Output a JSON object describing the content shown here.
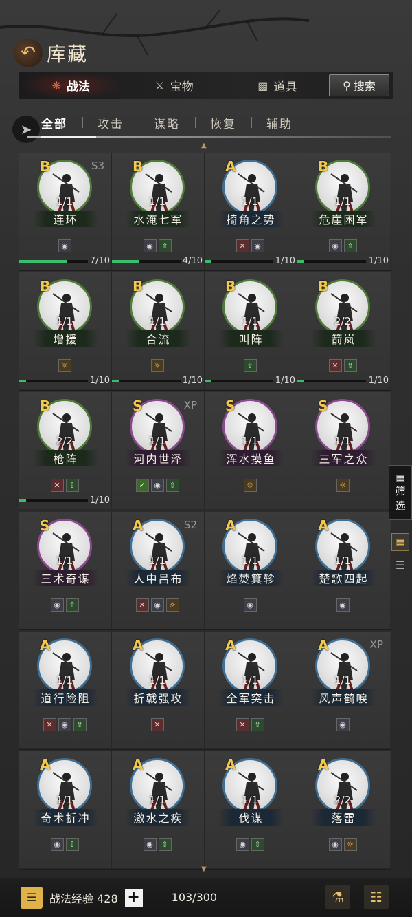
{
  "header": {
    "title": "库藏",
    "back_icon": "back-arrow-icon"
  },
  "category_tabs": [
    {
      "label": "战法",
      "icon": "scroll-icon",
      "active": true
    },
    {
      "label": "宝物",
      "icon": "treasure-icon",
      "active": false
    },
    {
      "label": "道具",
      "icon": "item-icon",
      "active": false
    }
  ],
  "search": {
    "label": "搜索"
  },
  "sub_tabs": [
    "全部",
    "攻击",
    "谋略",
    "恢复",
    "辅助"
  ],
  "skills": [
    [
      {
        "grade": "B",
        "tag": "S3",
        "count": "1/1",
        "name": "连环",
        "icons": [
          "shield"
        ],
        "progress": "7/10",
        "fill": 0.7
      },
      {
        "grade": "B",
        "tag": "",
        "count": "1/1",
        "name": "水淹七军",
        "icons": [
          "shield",
          "buff"
        ],
        "progress": "4/10",
        "fill": 0.4
      },
      {
        "grade": "A",
        "tag": "",
        "count": "1/1",
        "name": "掎角之势",
        "icons": [
          "attack",
          "shield"
        ],
        "progress": "1/10",
        "fill": 0.1
      },
      {
        "grade": "B",
        "tag": "",
        "count": "1/1",
        "name": "危崖困军",
        "icons": [
          "shield",
          "buff"
        ],
        "progress": "1/10",
        "fill": 0.1
      }
    ],
    [
      {
        "grade": "B",
        "tag": "",
        "count": "1/1",
        "name": "增援",
        "icons": [
          "special"
        ],
        "progress": "1/10",
        "fill": 0.1
      },
      {
        "grade": "B",
        "tag": "",
        "count": "1/1",
        "name": "合流",
        "icons": [
          "special"
        ],
        "progress": "1/10",
        "fill": 0.1
      },
      {
        "grade": "B",
        "tag": "",
        "count": "1/1",
        "name": "叫阵",
        "icons": [
          "buff"
        ],
        "progress": "1/10",
        "fill": 0.1
      },
      {
        "grade": "B",
        "tag": "",
        "count": "2/2",
        "name": "箭岚",
        "icons": [
          "attack",
          "buff"
        ],
        "progress": "1/10",
        "fill": 0.1
      }
    ],
    [
      {
        "grade": "B",
        "tag": "",
        "count": "2/2",
        "name": "枪阵",
        "icons": [
          "attack",
          "buff"
        ],
        "progress": "1/10",
        "fill": 0.1
      },
      {
        "grade": "S",
        "tag": "XP",
        "count": "1/1",
        "name": "河内世泽",
        "icons": [
          "green",
          "shield",
          "buff"
        ],
        "progress": "",
        "fill": 0
      },
      {
        "grade": "S",
        "tag": "",
        "count": "1/1",
        "name": "浑水摸鱼",
        "icons": [
          "special"
        ],
        "progress": "",
        "fill": 0
      },
      {
        "grade": "S",
        "tag": "",
        "count": "1/1",
        "name": "三军之众",
        "icons": [
          "special"
        ],
        "progress": "",
        "fill": 0
      }
    ],
    [
      {
        "grade": "S",
        "tag": "",
        "count": "1/1",
        "name": "三术奇谋",
        "icons": [
          "shield",
          "buff"
        ],
        "progress": "",
        "fill": 0
      },
      {
        "grade": "A",
        "tag": "S2",
        "count": "1/1",
        "name": "人中吕布",
        "icons": [
          "attack",
          "shield",
          "special"
        ],
        "progress": "",
        "fill": 0
      },
      {
        "grade": "A",
        "tag": "",
        "count": "1/1",
        "name": "焰焚箕轸",
        "icons": [
          "shield"
        ],
        "progress": "",
        "fill": 0
      },
      {
        "grade": "A",
        "tag": "",
        "count": "1/1",
        "name": "楚歌四起",
        "icons": [
          "shield"
        ],
        "progress": "",
        "fill": 0
      }
    ],
    [
      {
        "grade": "A",
        "tag": "",
        "count": "1/1",
        "name": "道行险阻",
        "icons": [
          "attack",
          "shield",
          "buff"
        ],
        "progress": "",
        "fill": 0
      },
      {
        "grade": "A",
        "tag": "",
        "count": "1/1",
        "name": "折戟强攻",
        "icons": [
          "attack"
        ],
        "progress": "",
        "fill": 0
      },
      {
        "grade": "A",
        "tag": "",
        "count": "1/1",
        "name": "全军突击",
        "icons": [
          "attack",
          "buff"
        ],
        "progress": "",
        "fill": 0
      },
      {
        "grade": "A",
        "tag": "XP",
        "count": "1/1",
        "name": "风声鹤唳",
        "icons": [
          "shield"
        ],
        "progress": "",
        "fill": 0
      }
    ],
    [
      {
        "grade": "A",
        "tag": "",
        "count": "1/1",
        "name": "奇术折冲",
        "icons": [
          "shield",
          "buff"
        ],
        "progress": "",
        "fill": 0
      },
      {
        "grade": "A",
        "tag": "",
        "count": "1/1",
        "name": "激水之疾",
        "icons": [
          "shield",
          "buff"
        ],
        "progress": "",
        "fill": 0
      },
      {
        "grade": "A",
        "tag": "",
        "count": "1/1",
        "name": "伐谋",
        "icons": [
          "shield",
          "buff"
        ],
        "progress": "",
        "fill": 0
      },
      {
        "grade": "A",
        "tag": "",
        "count": "2/2",
        "name": "落雷",
        "icons": [
          "shield",
          "special"
        ],
        "progress": "",
        "fill": 0
      }
    ]
  ],
  "side": {
    "filter_label_1": "筛",
    "filter_label_2": "选"
  },
  "footer": {
    "exp_label": "战法经验 428",
    "capacity": "103/300"
  },
  "colors": {
    "grade_text": "#f2c94c",
    "progress_fill": "#3dbd6a",
    "accent_red": "#e36a4f"
  }
}
